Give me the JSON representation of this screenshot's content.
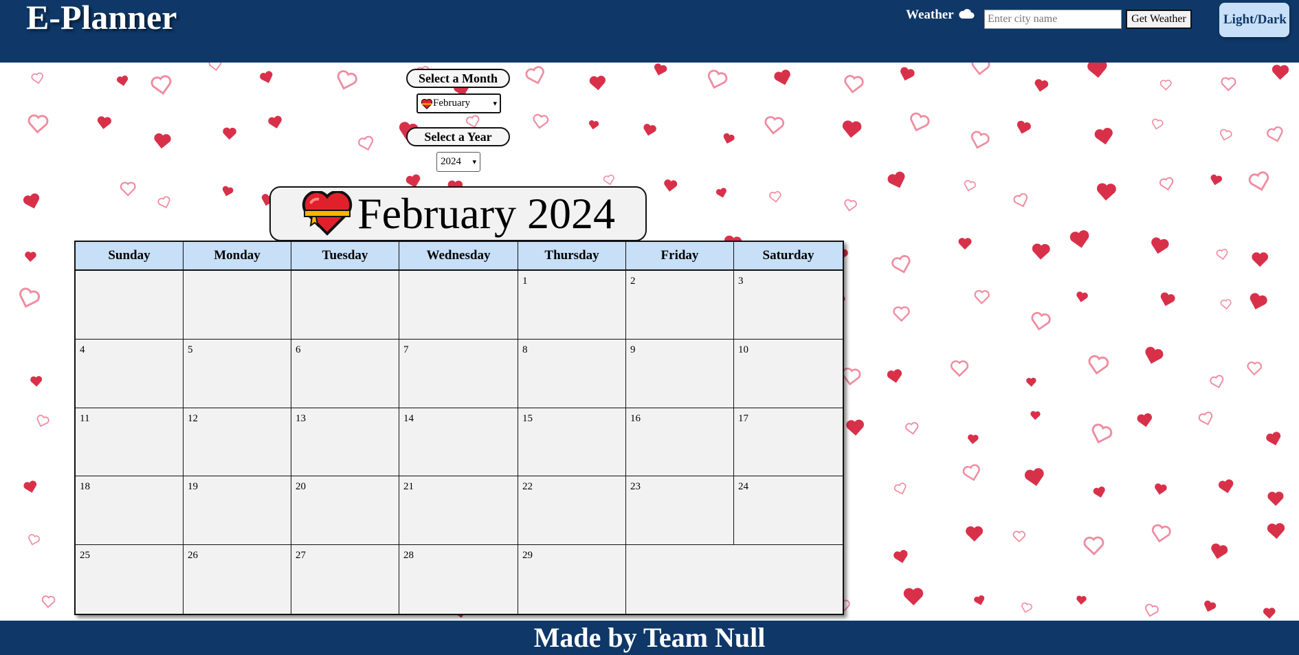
{
  "header": {
    "logo": "E-Planner",
    "weather_label": "Weather",
    "weather_icon": "cloud-icon",
    "city_placeholder": "Enter city name",
    "get_weather_label": "Get Weather",
    "theme_toggle_label": "Light/Dark"
  },
  "controls": {
    "month_label": "Select a Month",
    "month_selected": "February",
    "month_icon": "heart-icon",
    "year_label": "Select a Year",
    "year_selected": "2024"
  },
  "calendar": {
    "title": "February 2024",
    "title_icon": "heart-ribbon-icon",
    "weekdays": [
      "Sunday",
      "Monday",
      "Tuesday",
      "Wednesday",
      "Thursday",
      "Friday",
      "Saturday"
    ],
    "weeks": [
      [
        "",
        "",
        "",
        "",
        "1",
        "2",
        "3"
      ],
      [
        "4",
        "5",
        "6",
        "7",
        "8",
        "9",
        "10"
      ],
      [
        "11",
        "12",
        "13",
        "14",
        "15",
        "16",
        "17"
      ],
      [
        "18",
        "19",
        "20",
        "21",
        "22",
        "23",
        "24"
      ],
      [
        "25",
        "26",
        "27",
        "28",
        "29",
        "",
        ""
      ]
    ]
  },
  "footer": {
    "text": "Made by Team Null"
  },
  "colors": {
    "header_bg": "#0f3868",
    "weekday_header_bg": "#c7dff7",
    "cell_bg": "#f3f2f3",
    "heart_red": "#d9304a",
    "heart_pink": "#f08ca0"
  }
}
